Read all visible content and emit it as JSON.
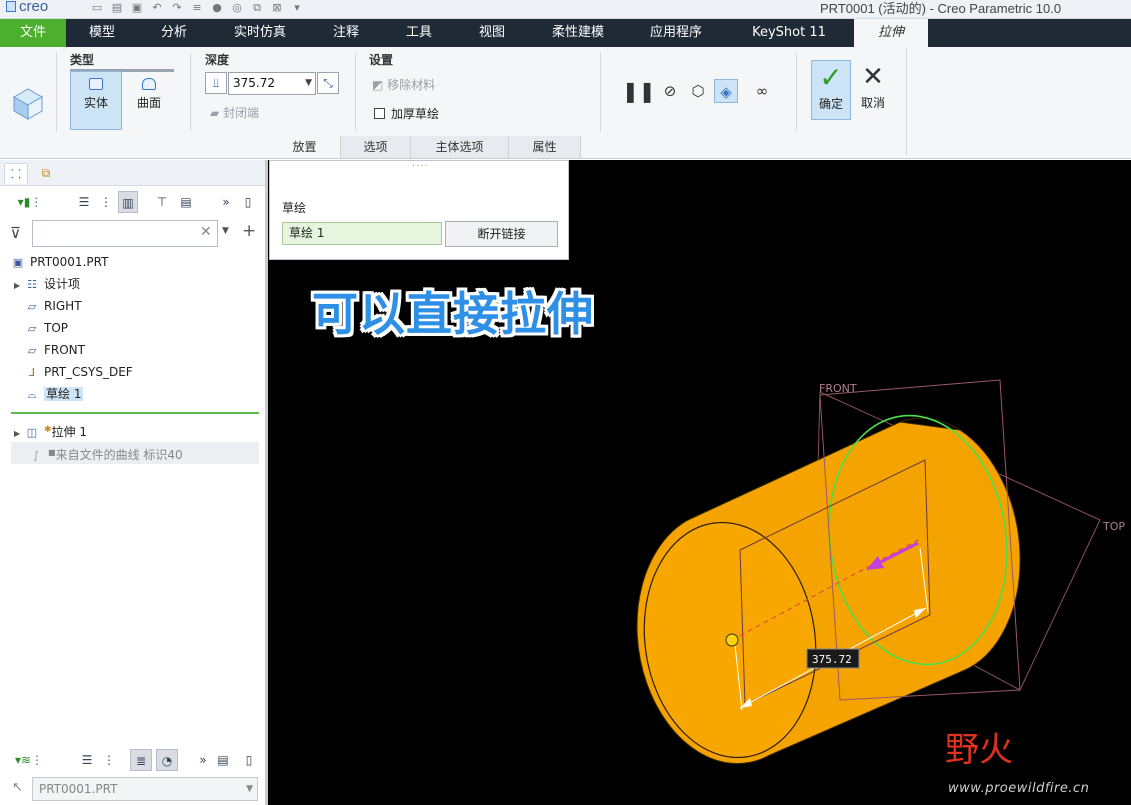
{
  "titlebar": {
    "app_logo": "creo",
    "window_title": "PRT0001 (活动的) - Creo Parametric 10.0"
  },
  "menu": {
    "tabs": [
      {
        "label": "文件"
      },
      {
        "label": "模型"
      },
      {
        "label": "分析"
      },
      {
        "label": "实时仿真"
      },
      {
        "label": "注释"
      },
      {
        "label": "工具"
      },
      {
        "label": "视图"
      },
      {
        "label": "柔性建模"
      },
      {
        "label": "应用程序"
      },
      {
        "label": "KeyShot 11"
      },
      {
        "label": "拉伸"
      }
    ]
  },
  "ribbon": {
    "type_group": {
      "label": "类型",
      "solid": "实体",
      "surface": "曲面"
    },
    "depth_group": {
      "label": "深度",
      "value": "375.72",
      "cap_ends": "封闭端"
    },
    "settings_group": {
      "label": "设置",
      "remove_material": "移除材料",
      "thicken_sketch": "加厚草绘"
    },
    "ok_label": "确定",
    "cancel_label": "取消",
    "subtabs": [
      {
        "label": "放置"
      },
      {
        "label": "选项"
      },
      {
        "label": "主体选项"
      },
      {
        "label": "属性"
      }
    ]
  },
  "placement": {
    "sketch_label": "草绘",
    "sketch_value": "草绘 1",
    "break_link": "断开链接"
  },
  "model_tree": {
    "search_placeholder": "",
    "items": [
      {
        "label": "PRT0001.PRT"
      },
      {
        "label": "设计项"
      },
      {
        "label": "RIGHT"
      },
      {
        "label": "TOP"
      },
      {
        "label": "FRONT"
      },
      {
        "label": "PRT_CSYS_DEF"
      },
      {
        "label": "草绘 1"
      },
      {
        "label": "拉伸 1"
      },
      {
        "label": "来自文件的曲线 标识40"
      }
    ],
    "bottom_model": "PRT0001.PRT"
  },
  "graphics": {
    "caption": "可以直接拉伸",
    "plane_front": "FRONT",
    "plane_top": "TOP",
    "dimension": "375.72",
    "body_color": "#f5a300"
  },
  "watermark": {
    "logo": "野火",
    "url": "www.proewildfire.cn"
  }
}
